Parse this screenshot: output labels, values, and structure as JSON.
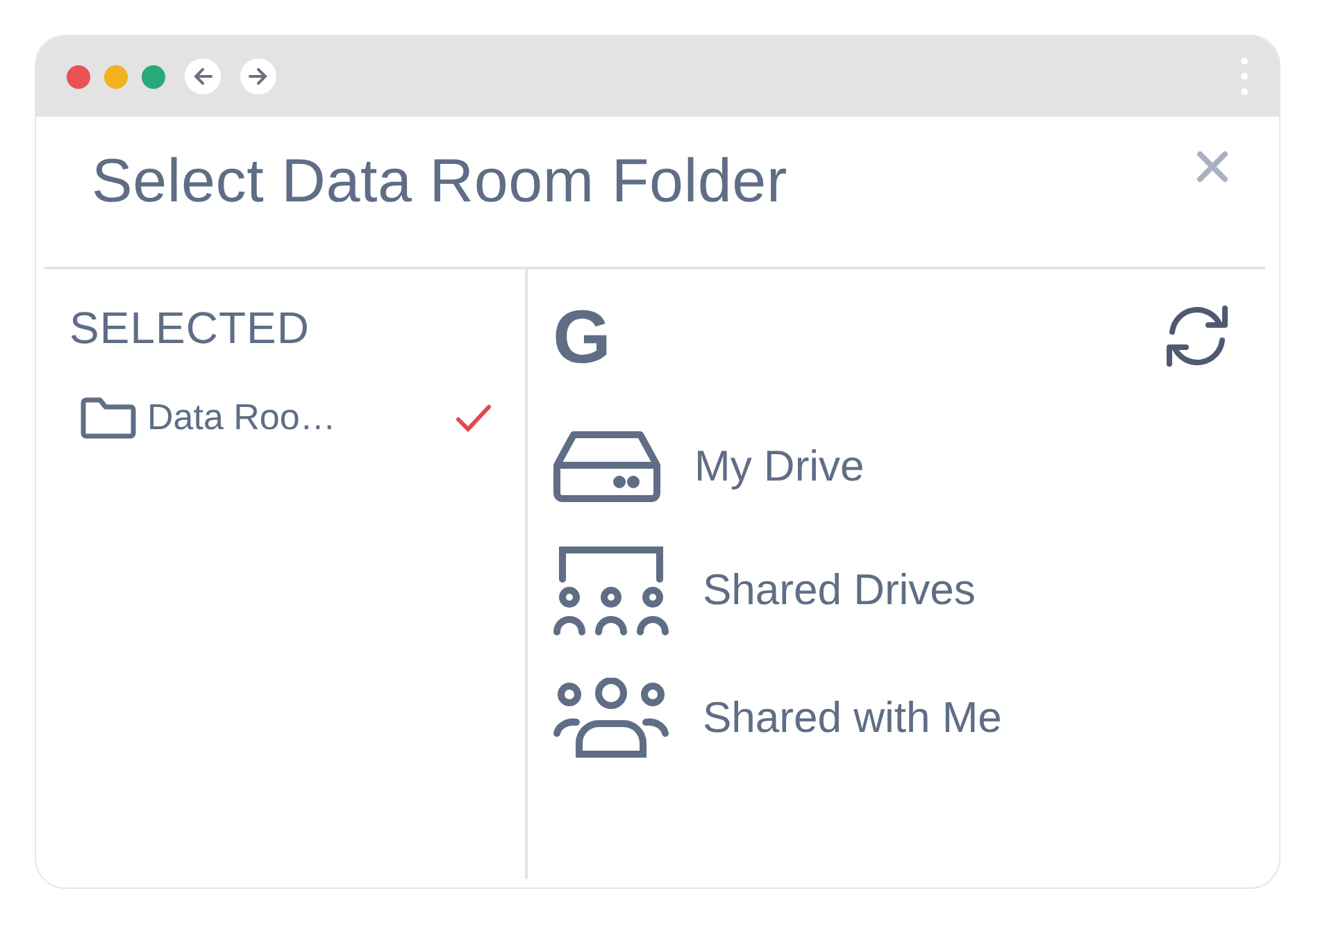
{
  "window": {
    "title": "Select Data Room Folder"
  },
  "selected_panel": {
    "heading": "SELECTED",
    "items": [
      {
        "name": "Data Roo…",
        "checked": true
      }
    ]
  },
  "source": {
    "logo": "G"
  },
  "locations": [
    {
      "kind": "drive",
      "label": "My Drive"
    },
    {
      "kind": "shared-drives",
      "label": "Shared Drives"
    },
    {
      "kind": "shared-with-me",
      "label": "Shared with Me"
    }
  ]
}
